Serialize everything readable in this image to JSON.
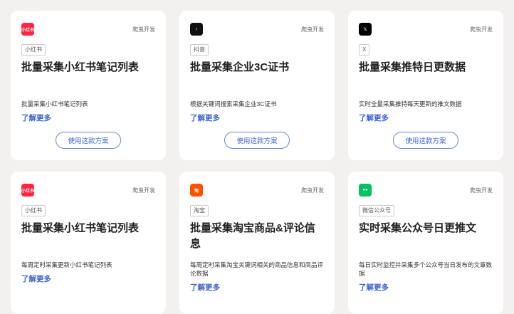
{
  "cards": [
    {
      "icon": "xiaohongshu-icon",
      "icon_text": "小红书",
      "icon_color": "#ff2442",
      "category": "爬虫开发",
      "tag": "小红书",
      "title": "批量采集小红书笔记列表",
      "desc": "批量采集小红书笔记列表",
      "link": "了解更多",
      "button": "使用这款方案"
    },
    {
      "icon": "douyin-icon",
      "icon_text": "♪",
      "icon_color": "#111111",
      "category": "爬虫开发",
      "tag": "抖音",
      "title": "批量采集企业3C证书",
      "desc": "根据关键词搜索采集企业3C证书",
      "link": "了解更多",
      "button": "使用这款方案"
    },
    {
      "icon": "x-icon",
      "icon_text": "𝕏",
      "icon_color": "#000000",
      "category": "爬虫开发",
      "tag": "X",
      "title": "批量采集推特日更数据",
      "desc": "实时全量采集推特每天更新的推文数据",
      "link": "了解更多",
      "button": "使用这款方案"
    },
    {
      "icon": "xiaohongshu-icon",
      "icon_text": "小红书",
      "icon_color": "#ff2442",
      "category": "爬虫开发",
      "tag": "小红书",
      "title": "批量采集小红书笔记列表",
      "desc": "每周定时采集更新小红书笔记列表",
      "link": "了解更多"
    },
    {
      "icon": "taobao-icon",
      "icon_text": "淘",
      "icon_color": "#ff5000",
      "category": "爬虫开发",
      "tag": "淘宝",
      "title": "批量采集淘宝商品&评论信息",
      "desc": "每周定时采集淘宝关键词相关的商品信息和商品评论数据",
      "link": "了解更多"
    },
    {
      "icon": "wechat-icon",
      "icon_text": "●●",
      "icon_color": "#07c160",
      "category": "爬虫开发",
      "tag": "微信公众号",
      "title": "实时采集公众号日更推文",
      "desc": "每日实时监控并采集多个公众号当日发布的文章数据",
      "link": "了解更多"
    }
  ]
}
